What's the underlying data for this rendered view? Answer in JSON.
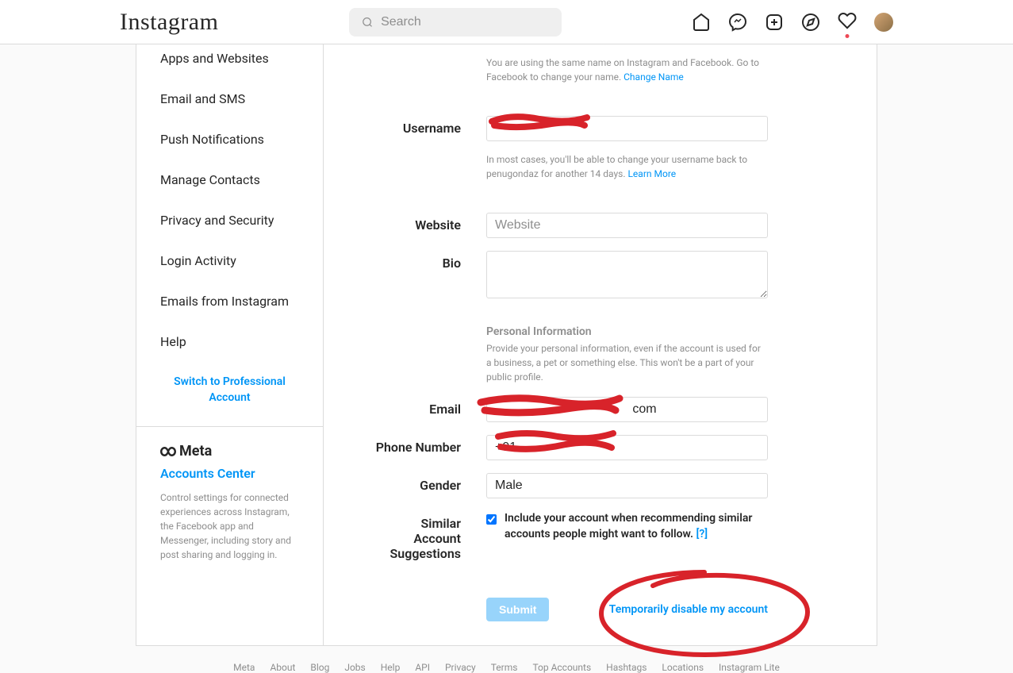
{
  "header": {
    "logo_text": "Instagram",
    "search_placeholder": "Search"
  },
  "sidebar": {
    "items": [
      "Apps and Websites",
      "Email and SMS",
      "Push Notifications",
      "Manage Contacts",
      "Privacy and Security",
      "Login Activity",
      "Emails from Instagram",
      "Help"
    ],
    "switch_label": "Switch to Professional Account"
  },
  "meta": {
    "brand": "Meta",
    "accounts_center": "Accounts Center",
    "description": "Control settings for connected experiences across Instagram, the Facebook app and Messenger, including story and post sharing and logging in."
  },
  "form": {
    "name_help": "You are using the same name on Instagram and Facebook. Go to Facebook to change your name. ",
    "name_help_link": "Change Name",
    "labels": {
      "username": "Username",
      "website": "Website",
      "bio": "Bio",
      "email": "Email",
      "phone": "Phone Number",
      "gender": "Gender",
      "similar1": "Similar Account",
      "similar2": "Suggestions"
    },
    "username_value": "",
    "username_help": "In most cases, you'll be able to change your username back to penugondaz for another 14 days. ",
    "username_help_link": "Learn More",
    "website_placeholder": "Website",
    "website_value": "",
    "bio_value": "",
    "personal_info_title": "Personal Information",
    "personal_info_desc": "Provide your personal information, even if the account is used for a business, a pet or something else. This won't be a part of your public profile.",
    "email_value": "                                       com",
    "phone_value": "+91",
    "gender_value": "Male",
    "checkbox_label": "Include your account when recommending similar accounts people might want to follow.  ",
    "checkbox_help": "[?]",
    "submit_label": "Submit",
    "disable_label": "Temporarily disable my account"
  },
  "footer": {
    "links": [
      "Meta",
      "About",
      "Blog",
      "Jobs",
      "Help",
      "API",
      "Privacy",
      "Terms",
      "Top Accounts",
      "Hashtags",
      "Locations",
      "Instagram Lite"
    ]
  }
}
